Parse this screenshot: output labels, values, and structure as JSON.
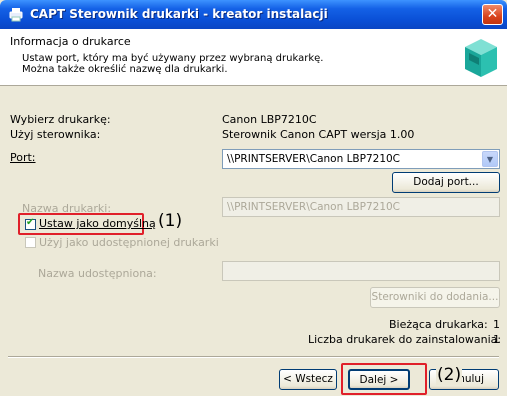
{
  "window": {
    "title": "CAPT Sterownik drukarki - kreator instalacji",
    "close_glyph": "✕"
  },
  "header": {
    "title": "Informacja o drukarce",
    "desc_line1": "Ustaw port, który ma być używany przez wybraną drukarkę.",
    "desc_line2": "Można także określić nazwę dla drukarki."
  },
  "info": {
    "printer_label": "Wybierz drukarkę:",
    "printer_value": "Canon LBP7210C",
    "driver_label": "Użyj sterownika:",
    "driver_value": "Sterownik Canon CAPT wersja 1.00",
    "port_label": "Port:",
    "port_value": "\\\\PRINTSERVER\\Canon LBP7210C",
    "add_port_button": "Dodaj port..."
  },
  "printer_name": {
    "label": "Nazwa drukarki:",
    "value": "\\\\PRINTSERVER\\Canon LBP7210C"
  },
  "options": {
    "default_label": "Ustaw jako domyślną",
    "default_checked": true,
    "share_label": "Użyj jako udostępnionej drukarki",
    "share_checked": false,
    "share_name_label": "Nazwa udostępniona:",
    "drivers_button": "Sterowniki do dodania..."
  },
  "counters": {
    "current_label": "Bieżąca drukarka:",
    "current_value": "1",
    "total_label": "Liczba drukarek do zainstalowania:",
    "total_value": "1"
  },
  "footer": {
    "back_button": "< Wstecz",
    "next_button": "Dalej >",
    "cancel_button": "Anuluj"
  },
  "annotations": {
    "callout1": "(1)",
    "callout2": "(2)",
    "highlight_color": "#e0202a"
  },
  "icons": {
    "app": "printer-icon",
    "header_image": "printer-3d-icon",
    "dropdown": "chevron-down-icon"
  }
}
